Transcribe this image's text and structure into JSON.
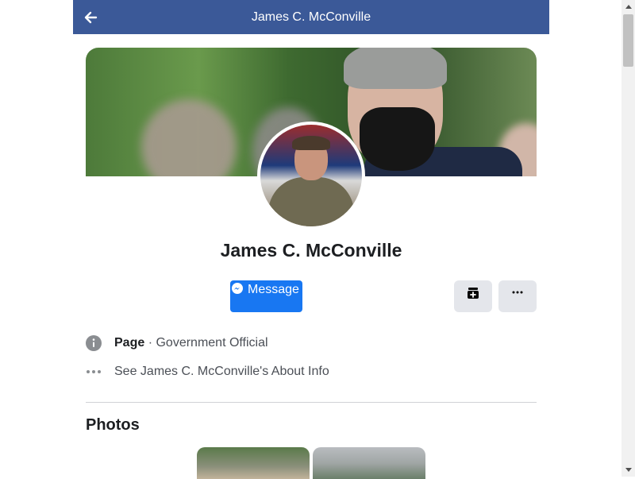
{
  "header": {
    "title": "James C. McConville"
  },
  "profile": {
    "name": "James C. McConville"
  },
  "actions": {
    "message_label": "Message"
  },
  "info": {
    "category_bold": "Page",
    "category_rest": " · Government Official",
    "about": "See James C. McConville's About Info"
  },
  "photos": {
    "title": "Photos"
  },
  "colors": {
    "header_bg": "#3b5998",
    "accent": "#1877f2",
    "button_bg": "#e4e6eb"
  }
}
